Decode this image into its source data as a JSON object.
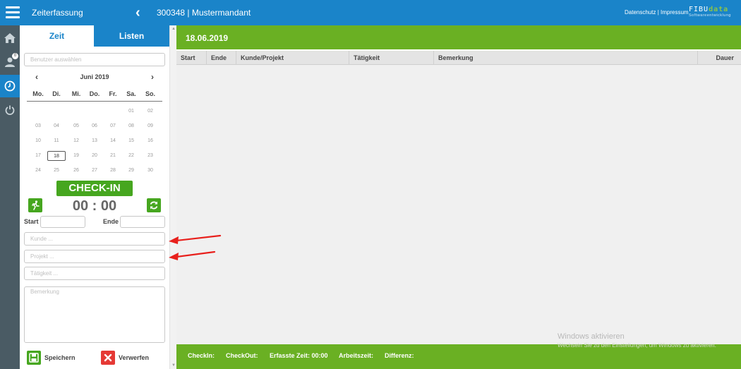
{
  "header": {
    "app_title": "Zeiterfassung",
    "mandant": "300348 | Mustermandant",
    "legal": "Datenschutz | Impressum",
    "logo_main": "FIBU",
    "logo_accent": "data",
    "logo_sub": "Softwareentwicklung"
  },
  "rail": {
    "items": [
      {
        "icon": "home-icon"
      },
      {
        "icon": "users-icon",
        "badge": "0"
      },
      {
        "icon": "clock-icon",
        "active": true
      },
      {
        "icon": "power-icon"
      }
    ]
  },
  "tabs": {
    "zeit": "Zeit",
    "listen": "Listen"
  },
  "user_select": {
    "placeholder": "Benutzer auswählen"
  },
  "calendar": {
    "month_label": "Juni 2019",
    "weekdays": [
      "Mo.",
      "Di.",
      "Mi.",
      "Do.",
      "Fr.",
      "Sa.",
      "So."
    ],
    "weeks": [
      [
        "",
        "",
        "",
        "",
        "",
        "01",
        "02"
      ],
      [
        "03",
        "04",
        "05",
        "06",
        "07",
        "08",
        "09"
      ],
      [
        "10",
        "11",
        "12",
        "13",
        "14",
        "15",
        "16"
      ],
      [
        "17",
        "18",
        "19",
        "20",
        "21",
        "22",
        "23"
      ],
      [
        "24",
        "25",
        "26",
        "27",
        "28",
        "29",
        "30"
      ]
    ],
    "selected": "18"
  },
  "checkin": {
    "button_label": "CHECK-IN",
    "timer": "00 : 00",
    "start_label": "Start",
    "end_label": "Ende"
  },
  "form": {
    "kunde_placeholder": "Kunde ...",
    "projekt_placeholder": "Projekt ...",
    "taetigkeit_placeholder": "Tätigkeit ...",
    "bemerkung_placeholder": "Bemerkung"
  },
  "actions": {
    "save": "Speichern",
    "discard": "Verwerfen"
  },
  "main": {
    "date": "18.06.2019",
    "columns": [
      "Start",
      "Ende",
      "Kunde/Projekt",
      "Tätigkeit",
      "Bemerkung",
      "Dauer"
    ]
  },
  "footer": {
    "checkin": "CheckIn:",
    "checkout": "CheckOut:",
    "erfasste_zeit": "Erfasste Zeit: 00:00",
    "arbeitszeit": "Arbeitszeit:",
    "differenz": "Differenz:"
  },
  "watermark": {
    "title": "Windows aktivieren",
    "subtitle": "Wechseln Sie zu den Einstellungen, um Windows zu aktivieren."
  },
  "colors": {
    "blue": "#1a84c9",
    "green": "#6ab023",
    "button_green": "#46a61f",
    "discard_red": "#e53935",
    "arrow_red": "#e8201c"
  }
}
